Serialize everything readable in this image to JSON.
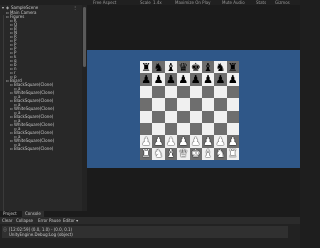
{
  "toolbar": {
    "game_view_label": "Game",
    "aspect": "Free Aspect",
    "scale": "Scale",
    "scale_value": "1.4x",
    "maximize": "Maximize On Play",
    "mute": "Mute Audio",
    "stats": "Stats",
    "gizmos": "Gizmos"
  },
  "hierarchy": {
    "scene_name": "SampleScene",
    "items": [
      {
        "label": "Main Camera",
        "indent": 1
      },
      {
        "label": "Figures",
        "indent": 1
      },
      {
        "label": "K",
        "indent": 2
      },
      {
        "label": "Q",
        "indent": 2
      },
      {
        "label": "B",
        "indent": 2
      },
      {
        "label": "N",
        "indent": 2
      },
      {
        "label": "R",
        "indent": 2
      },
      {
        "label": "P",
        "indent": 2
      },
      {
        "label": "P",
        "indent": 2
      },
      {
        "label": "P",
        "indent": 2
      },
      {
        "label": "P",
        "indent": 2
      },
      {
        "label": "k",
        "indent": 2
      },
      {
        "label": "q",
        "indent": 2
      },
      {
        "label": "b",
        "indent": 2
      },
      {
        "label": "n",
        "indent": 2
      },
      {
        "label": "r",
        "indent": 2
      },
      {
        "label": "p",
        "indent": 2
      },
      {
        "label": "Board",
        "indent": 1
      },
      {
        "label": "BlackSquare(Clone)",
        "indent": 2
      },
      {
        "label": "a",
        "indent": 3
      },
      {
        "label": "WhiteSquare(Clone)",
        "indent": 2
      },
      {
        "label": "a",
        "indent": 3
      },
      {
        "label": "BlackSquare(Clone)",
        "indent": 2
      },
      {
        "label": "a",
        "indent": 3
      },
      {
        "label": "WhiteSquare(Clone)",
        "indent": 2
      },
      {
        "label": "a",
        "indent": 3
      },
      {
        "label": "BlackSquare(Clone)",
        "indent": 2
      },
      {
        "label": "a",
        "indent": 3
      },
      {
        "label": "WhiteSquare(Clone)",
        "indent": 2
      },
      {
        "label": "a",
        "indent": 3
      },
      {
        "label": "BlackSquare(Clone)",
        "indent": 2
      },
      {
        "label": "a",
        "indent": 3
      },
      {
        "label": "WhiteSquare(Clone)",
        "indent": 2
      },
      {
        "label": "a",
        "indent": 3
      },
      {
        "label": "BlackSquare(Clone)",
        "indent": 2
      }
    ]
  },
  "board": {
    "rows": [
      "rnbqkbnr",
      "pppppppp",
      "........",
      "........",
      "........",
      "........",
      "PPPPPPPP",
      "RNBQKBNR"
    ]
  },
  "bottom": {
    "tabs": [
      "Project",
      "Console"
    ],
    "console_buttons": [
      "Clear",
      "Collapse",
      "Error Pause",
      "Editor ▾"
    ],
    "log_lines": [
      "[12:02:59] (0.0, 1.0) - (0.0, 0.1)",
      "UnityEngine.Debug:Log (object)"
    ]
  }
}
